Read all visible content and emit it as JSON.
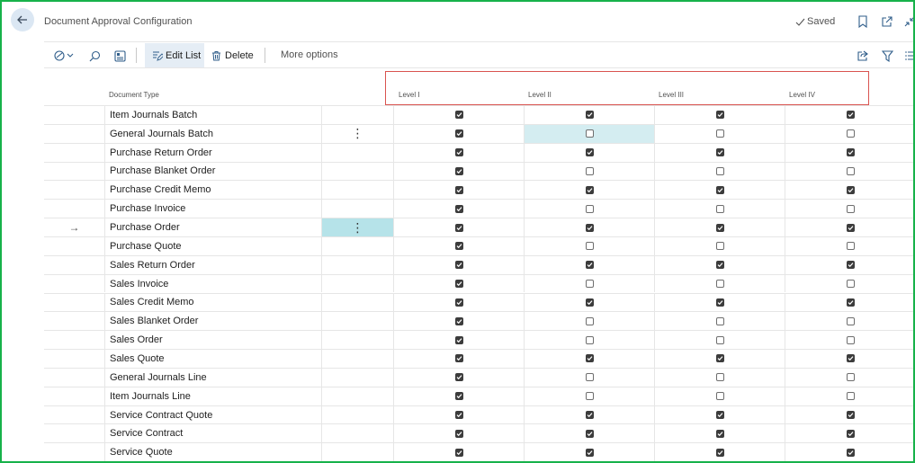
{
  "header": {
    "title": "Document Approval Configuration",
    "saved_label": "Saved"
  },
  "toolbar": {
    "edit_list_label": "Edit List",
    "delete_label": "Delete",
    "more_options_label": "More options"
  },
  "columns": {
    "document_type": "Document Type",
    "levels": [
      "Level I",
      "Level II",
      "Level III",
      "Level IV"
    ]
  },
  "rows": [
    {
      "type": "Item Journals Batch",
      "levels": [
        true,
        true,
        true,
        true
      ]
    },
    {
      "type": "General Journals Batch",
      "levels": [
        true,
        false,
        false,
        false
      ],
      "menu": true,
      "active_level": 1
    },
    {
      "type": "Purchase Return Order",
      "levels": [
        true,
        true,
        true,
        true
      ]
    },
    {
      "type": "Purchase Blanket Order",
      "levels": [
        true,
        false,
        false,
        false
      ]
    },
    {
      "type": "Purchase Credit Memo",
      "levels": [
        true,
        true,
        true,
        true
      ]
    },
    {
      "type": "Purchase Invoice",
      "levels": [
        true,
        false,
        false,
        false
      ]
    },
    {
      "type": "Purchase Order",
      "levels": [
        true,
        true,
        true,
        true
      ],
      "current": true,
      "menu": true,
      "menu_active": true
    },
    {
      "type": "Purchase Quote",
      "levels": [
        true,
        false,
        false,
        false
      ]
    },
    {
      "type": "Sales Return Order",
      "levels": [
        true,
        true,
        true,
        true
      ]
    },
    {
      "type": "Sales Invoice",
      "levels": [
        true,
        false,
        false,
        false
      ]
    },
    {
      "type": "Sales Credit Memo",
      "levels": [
        true,
        true,
        true,
        true
      ]
    },
    {
      "type": "Sales Blanket Order",
      "levels": [
        true,
        false,
        false,
        false
      ]
    },
    {
      "type": "Sales Order",
      "levels": [
        true,
        false,
        false,
        false
      ]
    },
    {
      "type": "Sales Quote",
      "levels": [
        true,
        true,
        true,
        true
      ]
    },
    {
      "type": "General Journals Line",
      "levels": [
        true,
        false,
        false,
        false
      ]
    },
    {
      "type": "Item Journals Line",
      "levels": [
        true,
        false,
        false,
        false
      ]
    },
    {
      "type": "Service Contract Quote",
      "levels": [
        true,
        true,
        true,
        true
      ]
    },
    {
      "type": "Service Contract",
      "levels": [
        true,
        true,
        true,
        true
      ]
    },
    {
      "type": "Service Quote",
      "levels": [
        true,
        true,
        true,
        true
      ]
    }
  ],
  "colors": {
    "frame": "#17b24a",
    "highlight_box": "#d9534f",
    "active_cell": "#b6e3e9",
    "checkbox_checked": "#3c3c3c"
  }
}
